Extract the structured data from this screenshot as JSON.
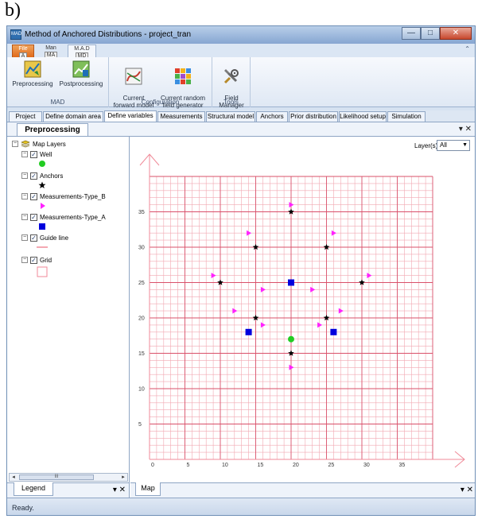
{
  "figure_label": "b)",
  "window": {
    "title": "Method of Anchored Distributions - project_tran",
    "icon_text": "MAD",
    "minimize": "—",
    "maximize": "□",
    "close": "✕"
  },
  "ribbon_tabs": [
    {
      "label": "File",
      "keytip": "A"
    },
    {
      "label": "Man",
      "keytip": "MA"
    },
    {
      "label": "M.A.D",
      "keytip": "MD"
    }
  ],
  "ribbon_minimize": "⌃",
  "ribbon_groups": [
    {
      "label": "MAD",
      "buttons": [
        "Preprocessing",
        "Postprocessing"
      ]
    },
    {
      "label": "Configuration",
      "buttons": [
        "Current\nforward model",
        "Current random\nfield generator"
      ]
    },
    {
      "label": "Tools",
      "buttons": [
        "Field\nManager"
      ]
    }
  ],
  "doc_tabs": [
    "Project",
    "Define domain area",
    "Define variables",
    "Measurements",
    "Structural model",
    "Anchors",
    "Prior distribution",
    "Likelihood setup",
    "Simulation"
  ],
  "active_doc_tab": "Define variables",
  "panel": {
    "tab_label": "Preprocessing",
    "controls": "▾ ✕"
  },
  "legend": {
    "root_label": "Map Layers",
    "layers": [
      {
        "label": "Well",
        "symbol": "green-circle"
      },
      {
        "label": "Anchors",
        "symbol": "black-star"
      },
      {
        "label": "Measurements-Type_B",
        "symbol": "magenta-triangle"
      },
      {
        "label": "Measurements-Type_A",
        "symbol": "blue-square"
      },
      {
        "label": "Guide line",
        "symbol": "pink-line"
      },
      {
        "label": "Grid",
        "symbol": "pink-box"
      }
    ],
    "bottom_tab": "Legend",
    "bottom_controls": "▾ ✕",
    "scroll_thumb": "III",
    "scroll_left": "◂",
    "scroll_right": "▸"
  },
  "map": {
    "layer_label": "Layer(s)",
    "layer_value": "All",
    "bottom_tab": "Map",
    "bottom_controls": "▾ ✕"
  },
  "status": "Ready.",
  "colors": {
    "grid_minor": "#f2a8b2",
    "grid_major": "#d9506a",
    "axis": "#f08a98",
    "well": "#22cc22",
    "anchor": "#000000",
    "type_b": "#ff22ff",
    "type_a": "#0000dd"
  },
  "chart_data": {
    "type": "scatter",
    "xlim": [
      0,
      40
    ],
    "ylim": [
      0,
      40
    ],
    "x_ticks": [
      0,
      5,
      10,
      15,
      20,
      25,
      30,
      35
    ],
    "y_ticks": [
      5,
      10,
      15,
      20,
      25,
      30,
      35
    ],
    "minor_step": 1,
    "major_step": 5,
    "series": [
      {
        "name": "Well",
        "marker": "circle",
        "points": [
          [
            20,
            17
          ]
        ]
      },
      {
        "name": "Anchors",
        "marker": "star",
        "points": [
          [
            20,
            35
          ],
          [
            15,
            30
          ],
          [
            25,
            30
          ],
          [
            10,
            25
          ],
          [
            30,
            25
          ],
          [
            15,
            20
          ],
          [
            25,
            20
          ],
          [
            20,
            15
          ]
        ]
      },
      {
        "name": "Measurements-Type_B",
        "marker": "triangle",
        "points": [
          [
            20,
            36
          ],
          [
            14,
            32
          ],
          [
            26,
            32
          ],
          [
            9,
            26
          ],
          [
            31,
            26
          ],
          [
            16,
            24
          ],
          [
            23,
            24
          ],
          [
            12,
            21
          ],
          [
            27,
            21
          ],
          [
            16,
            19
          ],
          [
            24,
            19
          ],
          [
            20,
            13
          ]
        ]
      },
      {
        "name": "Measurements-Type_A",
        "marker": "square",
        "points": [
          [
            20,
            25
          ],
          [
            14,
            18
          ],
          [
            26,
            18
          ]
        ]
      }
    ]
  }
}
